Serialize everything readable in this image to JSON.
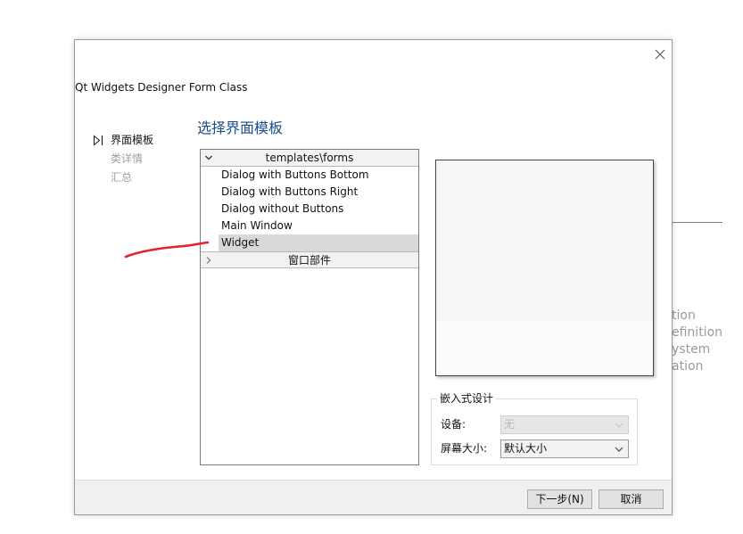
{
  "background": {
    "fragments": [
      "tion",
      "efinition",
      "ystem",
      "ation"
    ]
  },
  "dialog": {
    "title": "Qt Widgets Designer Form Class",
    "page_heading": "选择界面模板",
    "steps": [
      {
        "label": "界面模板",
        "state": "active"
      },
      {
        "label": "类详情",
        "state": "inactive"
      },
      {
        "label": "汇总",
        "state": "inactive"
      }
    ],
    "tree": {
      "expanded_group": "templates\\forms",
      "items": [
        {
          "label": "Dialog with Buttons Bottom"
        },
        {
          "label": "Dialog with Buttons Right"
        },
        {
          "label": "Dialog without Buttons"
        },
        {
          "label": "Main Window"
        },
        {
          "label": "Widget"
        }
      ],
      "selected": "Widget",
      "collapsed_group": "窗口部件"
    },
    "embedded": {
      "title": "嵌入式设计",
      "device_label": "设备:",
      "device_value": "无",
      "screen_label": "屏幕大小:",
      "screen_value": "默认大小"
    },
    "buttons": {
      "next": "下一步(N)",
      "cancel": "取消"
    }
  },
  "colors": {
    "heading": "#1a4c8a",
    "annotation": "#e0242a",
    "selection": "#d9d9d9"
  },
  "icons": {
    "close": "close-icon",
    "step_marker": "step-arrow-icon",
    "expand": "chevron-down-icon",
    "collapse": "chevron-right-icon",
    "combo": "chevron-down-icon"
  }
}
